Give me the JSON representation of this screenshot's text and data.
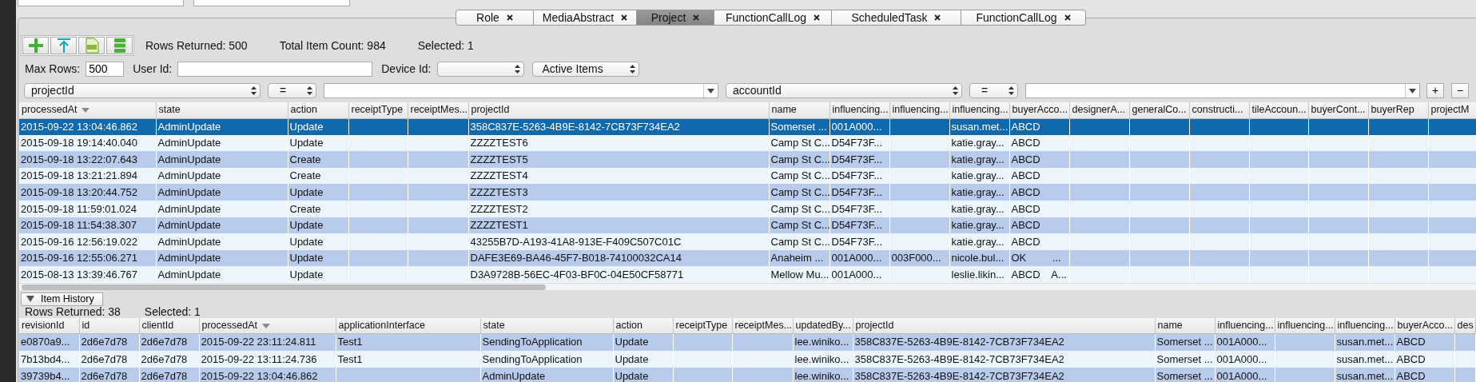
{
  "tabs": [
    {
      "label": "Role",
      "selected": false
    },
    {
      "label": "MediaAbstract",
      "selected": false
    },
    {
      "label": "Project",
      "selected": true
    },
    {
      "label": "FunctionCallLog",
      "selected": false
    },
    {
      "label": "ScheduledTask",
      "selected": false
    },
    {
      "label": "FunctionCallLog",
      "selected": false
    }
  ],
  "toolbar": {
    "buttons": [
      {
        "kind": "add"
      },
      {
        "kind": "upload"
      },
      {
        "kind": "csv"
      },
      {
        "kind": "list"
      }
    ],
    "stats": [
      "Rows Returned: 500",
      "Total Item Count: 984",
      "Selected: 1"
    ]
  },
  "options": {
    "max_rows": {
      "label": "Max Rows:",
      "value": "500"
    },
    "user_id": {
      "label": "User Id:"
    },
    "device_id": {
      "label": "Device Id:"
    },
    "scope": {
      "value": "Active Items"
    }
  },
  "query_filters": [
    {
      "field": "projectId",
      "operator": "="
    },
    {
      "field": "accountId",
      "operator": "="
    }
  ],
  "filter_buttons": [
    "+",
    "−"
  ],
  "main_table": {
    "columns": [
      {
        "label": "processedAt",
        "sorted": true
      },
      {
        "label": "state",
        "sorted": false
      },
      {
        "label": "action",
        "sorted": false
      },
      {
        "label": "receiptType",
        "sorted": false
      },
      {
        "label": "receiptMes...",
        "sorted": false
      },
      {
        "label": "projectId",
        "sorted": false
      },
      {
        "label": "name",
        "sorted": false
      },
      {
        "label": "influencing...",
        "sorted": false
      },
      {
        "label": "influencing...",
        "sorted": false
      },
      {
        "label": "influencing...",
        "sorted": false
      },
      {
        "label": "buyerAcco...",
        "sorted": false
      },
      {
        "label": "designerA...",
        "sorted": false
      },
      {
        "label": "generalCo...",
        "sorted": false
      },
      {
        "label": "constructi...",
        "sorted": false
      },
      {
        "label": "tileAccoun...",
        "sorted": false
      },
      {
        "label": "buyerCont...",
        "sorted": false
      },
      {
        "label": "buyerRep",
        "sorted": false
      },
      {
        "label": "projectM",
        "sorted": false
      }
    ],
    "rows": [
      {
        "selected": true,
        "cells": [
          "2015-09-22 13:04:46.862",
          "AdminUpdate",
          "Update",
          null,
          null,
          "358C837E-5263-4B9E-8142-7CB73F734EA2",
          "Somerset ...",
          "001A000...",
          null,
          "susan.met...",
          "ABCD"
        ]
      },
      {
        "selected": false,
        "cells": [
          "2015-09-18 19:14:40.040",
          "AdminUpdate",
          "Update",
          null,
          null,
          "ZZZZTEST6",
          "Camp St C...",
          "D54F73F...",
          null,
          "katie.gray...",
          "ABCD"
        ]
      },
      {
        "selected": false,
        "cells": [
          "2015-09-18 13:22:07.643",
          "AdminUpdate",
          "Create",
          null,
          null,
          "ZZZZTEST5",
          "Camp St C...",
          "D54F73F...",
          null,
          "katie.gray...",
          "ABCD"
        ]
      },
      {
        "selected": false,
        "cells": [
          "2015-09-18 13:21:21.894",
          "AdminUpdate",
          "Create",
          null,
          null,
          "ZZZZTEST4",
          "Camp St C...",
          "D54F73F...",
          null,
          "katie.gray...",
          "ABCD"
        ]
      },
      {
        "selected": false,
        "cells": [
          "2015-09-18 13:20:44.752",
          "AdminUpdate",
          "Update",
          null,
          null,
          "ZZZZTEST3",
          "Camp St C...",
          "D54F73F...",
          null,
          "katie.gray...",
          "ABCD"
        ]
      },
      {
        "selected": false,
        "cells": [
          "2015-09-18 11:59:01.024",
          "AdminUpdate",
          "Create",
          null,
          null,
          "ZZZZTEST2",
          "Camp St C...",
          "D54F73F...",
          null,
          "katie.gray...",
          "ABCD"
        ]
      },
      {
        "selected": false,
        "cells": [
          "2015-09-18 11:54:38.307",
          "AdminUpdate",
          "Update",
          null,
          null,
          "ZZZZTEST1",
          "Camp St C...",
          "D54F73F...",
          null,
          "katie.gray...",
          "ABCD"
        ]
      },
      {
        "selected": false,
        "cells": [
          "2015-09-16 12:56:19.022",
          "AdminUpdate",
          "Update",
          null,
          null,
          "43255B7D-A193-41A8-913E-F409C507C01C",
          "Camp St C...",
          "D54F73F...",
          null,
          "katie.gray...",
          "ABCD"
        ]
      },
      {
        "selected": false,
        "cells": [
          "2015-09-16 12:55:06.271",
          "AdminUpdate",
          "Update",
          null,
          null,
          "DAFE3E69-BA46-45F7-B018-74100032CA14",
          "Anaheim ...",
          "001A000...",
          "003F000...",
          "nicole.bul...",
          "OK         ..."
        ]
      },
      {
        "selected": false,
        "cells": [
          "2015-08-13 13:39:46.767",
          "AdminUpdate",
          "Update",
          null,
          null,
          "D3A9728B-56EC-4F03-BF0C-04E50CF58771",
          "Mellow Mu...",
          "001A000...",
          null,
          "leslie.likin...",
          "ABCD    A..."
        ]
      }
    ]
  },
  "item_history": {
    "toggle": {
      "label": "Item History",
      "expanded": true
    },
    "stats": [
      "Rows Returned: 38",
      "Selected: 1"
    ],
    "table": {
      "columns": [
        {
          "label": "revisionId",
          "sorted": false
        },
        {
          "label": "id",
          "sorted": false
        },
        {
          "label": "clientId",
          "sorted": false
        },
        {
          "label": "processedAt",
          "sorted": true
        },
        {
          "label": "applicationInterface",
          "sorted": false
        },
        {
          "label": "state",
          "sorted": false
        },
        {
          "label": "action",
          "sorted": false
        },
        {
          "label": "receiptType",
          "sorted": false
        },
        {
          "label": "receiptMes...",
          "sorted": false
        },
        {
          "label": "updatedBy...",
          "sorted": false
        },
        {
          "label": "projectId",
          "sorted": false
        },
        {
          "label": "name",
          "sorted": false
        },
        {
          "label": "influencing...",
          "sorted": false
        },
        {
          "label": "influencing...",
          "sorted": false
        },
        {
          "label": "influencing...",
          "sorted": false
        },
        {
          "label": "buyerAcco...",
          "sorted": false
        },
        {
          "label": "des",
          "sorted": false
        }
      ],
      "rows": [
        {
          "selected": false,
          "cells": [
            "e0870a9...",
            "2d6e7d78",
            "2d6e7d78",
            "2015-09-22 23:11:24.811",
            "Test1",
            "SendingToApplication",
            "Update",
            null,
            null,
            "lee.winiko...",
            "358C837E-5263-4B9E-8142-7CB73F734EA2",
            "Somerset ...",
            "001A000...",
            null,
            "susan.met...",
            "ABCD"
          ]
        },
        {
          "selected": false,
          "cells": [
            "7b13bd4...",
            "2d6e7d78",
            "2d6e7d78",
            "2015-09-22 13:11:24.736",
            "Test1",
            "SendingToApplication",
            "Update",
            null,
            null,
            "lee.winiko...",
            "358C837E-5263-4B9E-8142-7CB73F734EA2",
            "Somerset ...",
            "001A000...",
            null,
            "susan.met...",
            "ABCD"
          ]
        },
        {
          "selected": false,
          "cells": [
            "39739b4...",
            "2d6e7d78",
            "2d6e7d78",
            "2015-09-22 13:04:46.862",
            null,
            "AdminUpdate",
            "Update",
            null,
            null,
            "lee.winiko...",
            "358C837E-5263-4B9E-8142-7CB73F734EA2",
            "Somerset ...",
            "001A000...",
            null,
            "susan.met...",
            "ABCD"
          ]
        }
      ]
    }
  }
}
